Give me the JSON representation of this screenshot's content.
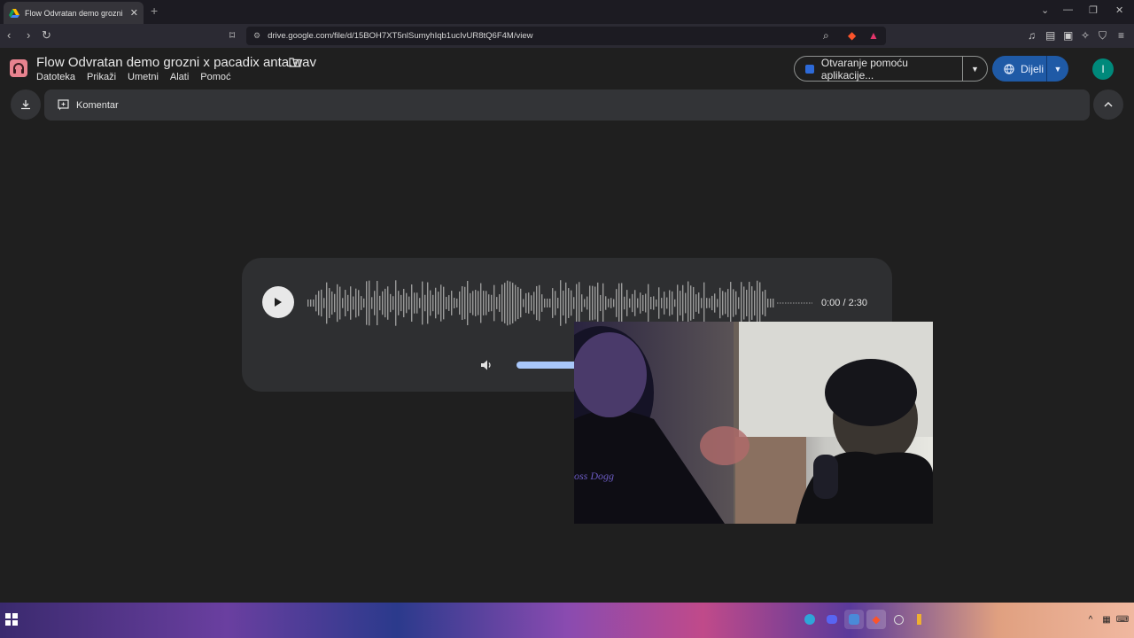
{
  "browser": {
    "tab_title": "Flow Odvratan demo grozni x pac",
    "new_tab": "+",
    "url": "drive.google.com/file/d/15BOH7XT5nlSumyhIqb1ucIvUR8tQ6F4M/view",
    "window_controls": [
      "⌄",
      "—",
      "❐",
      "✕"
    ]
  },
  "drive": {
    "file_title": "Flow Odvratan demo grozni x pacadix anta.wav",
    "menu": [
      "Datoteka",
      "Prikaži",
      "Umetni",
      "Alati",
      "Pomoć"
    ],
    "open_with_label": "Otvaranje pomoću aplikacije...",
    "share_label": "Dijeli",
    "avatar_initial": "I",
    "comment_label": "Komentar"
  },
  "player": {
    "time": "0:00 / 2:30",
    "volume_level": 0.6,
    "progress": 0.0
  },
  "colors": {
    "accent": "#a8c7fa",
    "share_button": "#1f5aa6",
    "avatar": "#00897b"
  },
  "icons": [
    "drive-icon",
    "play-icon",
    "volume-icon",
    "download-icon",
    "comment-icon",
    "chevron-up-icon",
    "globe-icon",
    "folder-icon"
  ]
}
